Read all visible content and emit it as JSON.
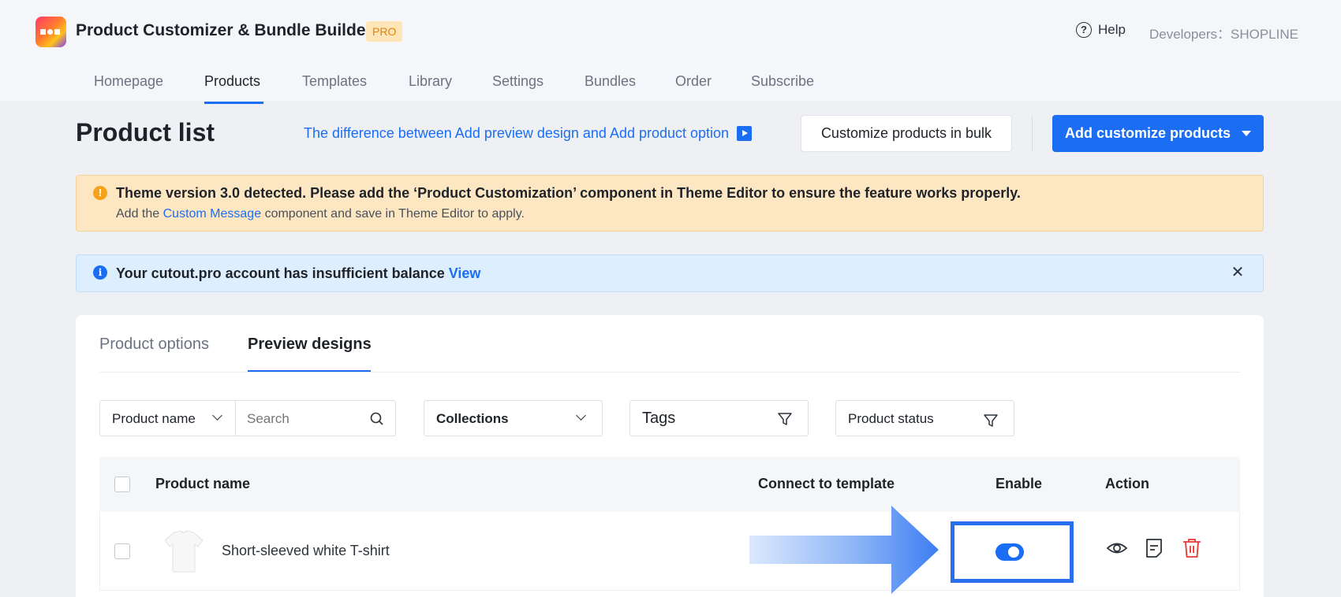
{
  "app": {
    "title": "Product Customizer & Bundle Builder",
    "badge": "PRO",
    "help_label": "Help",
    "developers": "Developers：SHOPLINE"
  },
  "nav": {
    "items": [
      "Homepage",
      "Products",
      "Templates",
      "Library",
      "Settings",
      "Bundles",
      "Order",
      "Subscribe"
    ],
    "active": "Products"
  },
  "header": {
    "title": "Product list",
    "difference_link": "The difference between Add preview design and Add product option",
    "bulk_button": "Customize products in bulk",
    "add_button": "Add customize products"
  },
  "warning_banner": {
    "title": "Theme version 3.0 detected. Please add the ‘Product Customization’ component in Theme Editor to ensure the feature works properly.",
    "sub_prefix": "Add the",
    "sub_link": "Custom Message",
    "sub_suffix": "component and save in Theme Editor to apply."
  },
  "info_banner": {
    "text": "Your cutout.pro account has insufficient balance",
    "link": "View"
  },
  "tabs": [
    "Product options",
    "Preview designs"
  ],
  "active_tab": "Preview designs",
  "filters": {
    "product_name_select": "Product name",
    "search_placeholder": "Search",
    "collections": "Collections",
    "tags": "Tags",
    "product_status": "Product status"
  },
  "table": {
    "columns": [
      "Product name",
      "Connect to template",
      "Enable",
      "Action"
    ],
    "rows": [
      {
        "name": "Short-sleeved white T-shirt",
        "connect_to_template": "",
        "enabled": true
      }
    ]
  },
  "colors": {
    "primary": "#1b6ef3",
    "warning_bg": "#fde7c3",
    "info_bg": "#ddeefe",
    "danger": "#e53935",
    "annotation": "#2a6ef0"
  }
}
